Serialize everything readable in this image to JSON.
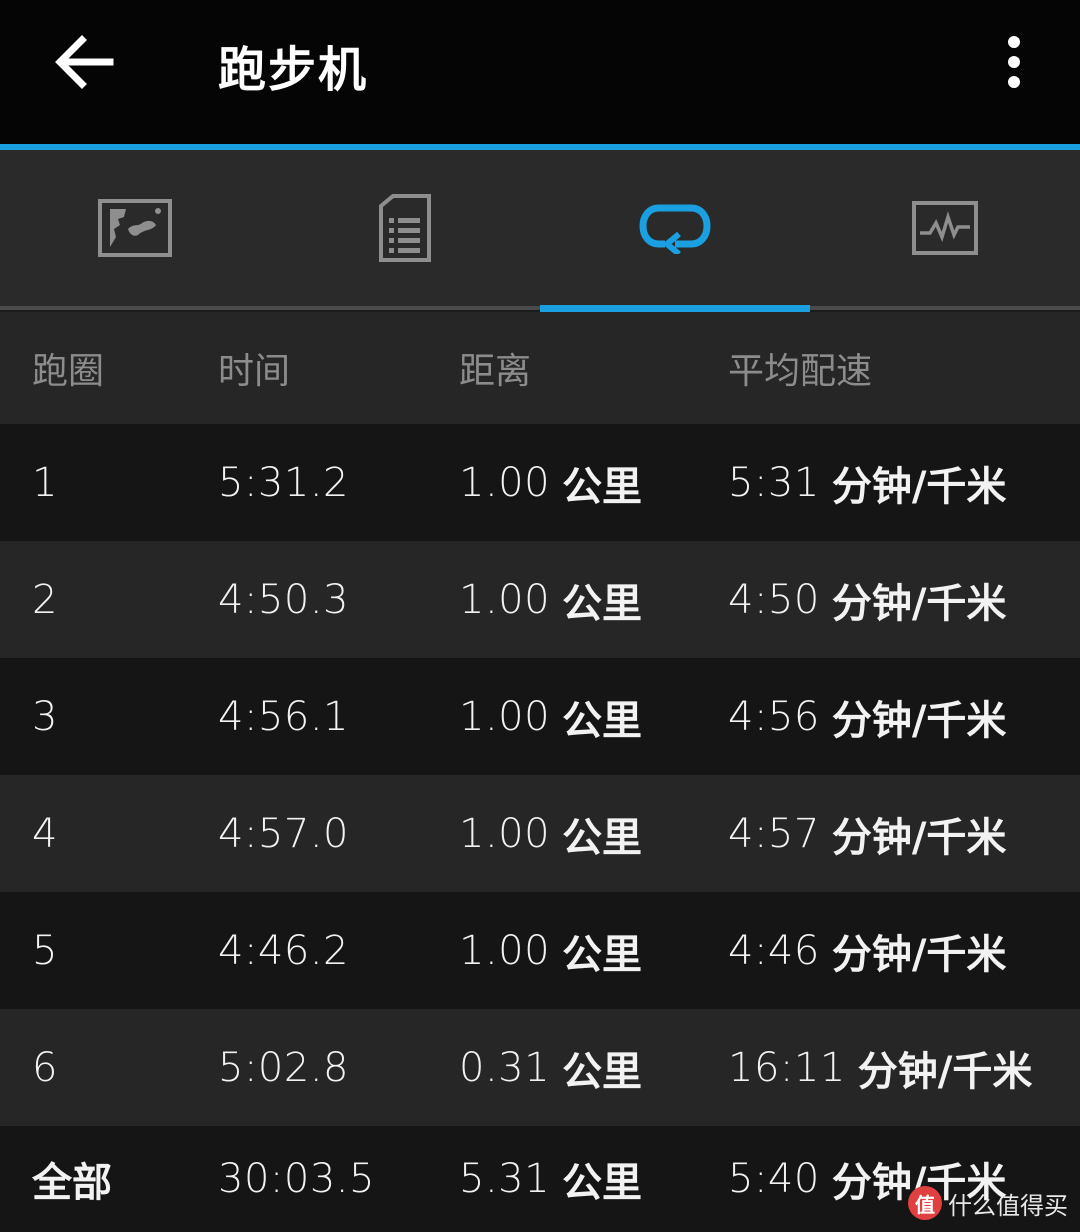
{
  "appbar": {
    "title": "跑步机",
    "back_icon": "arrow-left-icon",
    "more_icon": "more-vertical-icon"
  },
  "tabs": [
    {
      "icon": "map-icon",
      "selected": false
    },
    {
      "icon": "document-list-icon",
      "selected": false
    },
    {
      "icon": "laps-loop-icon",
      "selected": true
    },
    {
      "icon": "activity-chart-icon",
      "selected": false
    }
  ],
  "colors": {
    "accent": "#1a9fe0"
  },
  "table": {
    "headers": [
      "跑圈",
      "时间",
      "距离",
      "平均配速"
    ],
    "rows": [
      {
        "lap": "1",
        "time": "5:31.2",
        "dist": "1.00",
        "dist_unit": "公里",
        "pace": "5:31",
        "pace_unit": "分钟/千米"
      },
      {
        "lap": "2",
        "time": "4:50.3",
        "dist": "1.00",
        "dist_unit": "公里",
        "pace": "4:50",
        "pace_unit": "分钟/千米"
      },
      {
        "lap": "3",
        "time": "4:56.1",
        "dist": "1.00",
        "dist_unit": "公里",
        "pace": "4:56",
        "pace_unit": "分钟/千米"
      },
      {
        "lap": "4",
        "time": "4:57.0",
        "dist": "1.00",
        "dist_unit": "公里",
        "pace": "4:57",
        "pace_unit": "分钟/千米"
      },
      {
        "lap": "5",
        "time": "4:46.2",
        "dist": "1.00",
        "dist_unit": "公里",
        "pace": "4:46",
        "pace_unit": "分钟/千米"
      },
      {
        "lap": "6",
        "time": "5:02.8",
        "dist": "0.31",
        "dist_unit": "公里",
        "pace": "16:11",
        "pace_unit": "分钟/千米"
      }
    ],
    "total": {
      "lap": "全部",
      "time": "30:03.5",
      "dist": "5.31",
      "dist_unit": "公里",
      "pace": "5:40",
      "pace_unit": "分钟/千米"
    }
  },
  "watermark": {
    "logo_text": "值",
    "text": "什么值得买"
  }
}
